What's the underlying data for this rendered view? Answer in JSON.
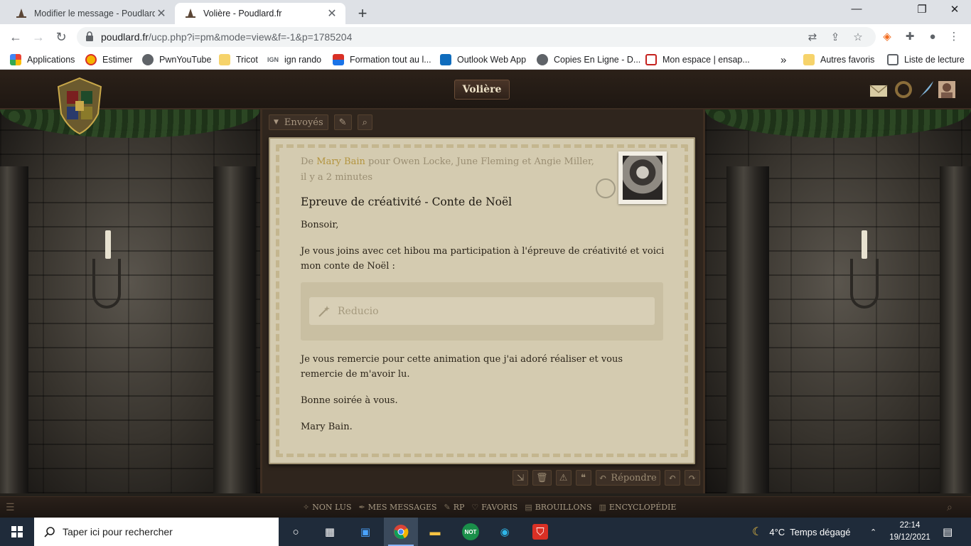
{
  "browser": {
    "tabs": [
      {
        "title": "Modifier le message - Poudlard.fr",
        "close": "✕"
      },
      {
        "title": "Volière - Poudlard.fr",
        "close": "✕"
      }
    ],
    "new_tab": "+",
    "window_controls": {
      "minimize": "—",
      "maximize": "❐",
      "close": "✕"
    },
    "nav": {
      "back": "←",
      "forward": "→",
      "reload": "↻"
    },
    "url": {
      "host": "poudlard.fr",
      "path": "/ucp.php?i=pm&mode=view&f=-1&p=1785204"
    },
    "bookmarks": [
      {
        "label": "Applications",
        "icon": "apps-grid-icon",
        "color": "#ea4335"
      },
      {
        "label": "Estimer",
        "icon": "estimer-icon",
        "color": "#f4b400"
      },
      {
        "label": "PwnYouTube",
        "icon": "globe-icon",
        "color": "#5f6368"
      },
      {
        "label": "Tricot",
        "icon": "folder-icon",
        "color": "#f6d36b"
      },
      {
        "label": "ign rando",
        "icon": "ign-icon",
        "color": "#5f6368"
      },
      {
        "label": "Formation tout au l...",
        "icon": "formation-icon",
        "color": "#d93025"
      },
      {
        "label": "Outlook Web App",
        "icon": "outlook-icon",
        "color": "#0f6cbd"
      },
      {
        "label": "Copies En Ligne - D...",
        "icon": "globe-icon",
        "color": "#5f6368"
      },
      {
        "label": "Mon espace | ensap...",
        "icon": "ensap-icon",
        "color": "#c5221f"
      }
    ],
    "more_bookmarks": "»",
    "other_bookmarks": "Autres favoris",
    "reading_list": "Liste de lecture"
  },
  "site": {
    "header_title": "Volière",
    "folder_label": "Envoyés",
    "letter": {
      "from_prefix": "De",
      "author": "Mary Bain",
      "recipients": "pour Owen Locke, June Fleming et Angie Miller,",
      "time": "il y a 2 minutes",
      "subject": "Epreuve de créativité - Conte de Noël",
      "greeting": "Bonsoir,",
      "para1": "Je vous joins avec cet hibou ma participation à l'épreuve de créativité et voici mon conte de Noël :",
      "spoiler_label": "Reducio",
      "para2": "Je vous remercie pour cette animation que j'ai adoré réaliser et vous remercie de m'avoir lu.",
      "closing": "Bonne soirée à vous.",
      "signature": "Mary Bain."
    },
    "actions": {
      "reply": "Répondre"
    },
    "footer": [
      "NON LUS",
      "MES MESSAGES",
      "RP",
      "FAVORIS",
      "BROUILLONS",
      "ENCYCLOPÉDIE"
    ]
  },
  "taskbar": {
    "search_placeholder": "Taper ici pour rechercher",
    "weather": "4°C  Temps dégagé",
    "time": "22:14",
    "date": "19/12/2021"
  },
  "colors": {
    "accent_author": "#b3943e",
    "letter_bg": "#d4cbb0"
  }
}
